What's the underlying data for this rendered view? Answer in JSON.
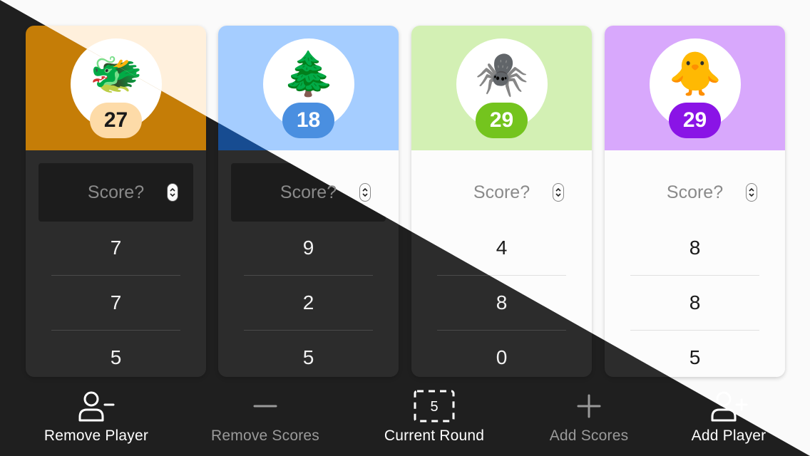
{
  "players": [
    {
      "emoji": "🐲",
      "total": "27",
      "score_placeholder": "Score?",
      "scores": [
        "7",
        "7",
        "5"
      ],
      "header_color_light": "#fff0dc",
      "header_color_dark": "#c57d07",
      "badge_color_light": "#fddba8",
      "badge_color_dark": "#fddba8",
      "badge_text_color": "#1a1a1a"
    },
    {
      "emoji": "🌲",
      "total": "18",
      "score_placeholder": "Score?",
      "scores": [
        "9",
        "2",
        "5"
      ],
      "header_color_light": "#a5cdff",
      "header_color_dark": "#174c91",
      "badge_color_light": "#4a8fe0",
      "badge_color_dark": "#4a8fe0",
      "badge_text_color": "#ffffff"
    },
    {
      "emoji": "🕷️",
      "total": "29",
      "score_placeholder": "Score?",
      "scores": [
        "4",
        "8",
        "0"
      ],
      "header_color_light": "#d3f0b4",
      "header_color_dark": "#3e6b1c",
      "badge_color_light": "#74c41e",
      "badge_color_dark": "#74c41e",
      "badge_text_color": "#ffffff"
    },
    {
      "emoji": "🐥",
      "total": "29",
      "score_placeholder": "Score?",
      "scores": [
        "8",
        "8",
        "5"
      ],
      "header_color_light": "#d8a8fc",
      "header_color_dark": "#6a2aa0",
      "badge_color_light": "#8a14e6",
      "badge_color_dark": "#8a14e6",
      "badge_text_color": "#ffffff"
    }
  ],
  "toolbar": {
    "remove_player": "Remove Player",
    "remove_scores": "Remove Scores",
    "current_round": "Current Round",
    "current_round_value": "5",
    "add_scores": "Add Scores",
    "add_player": "Add Player"
  },
  "colors": {
    "light_background": "#fafafa",
    "dark_background": "#1f1f1f",
    "disabled_text": "#9a9a9a"
  }
}
